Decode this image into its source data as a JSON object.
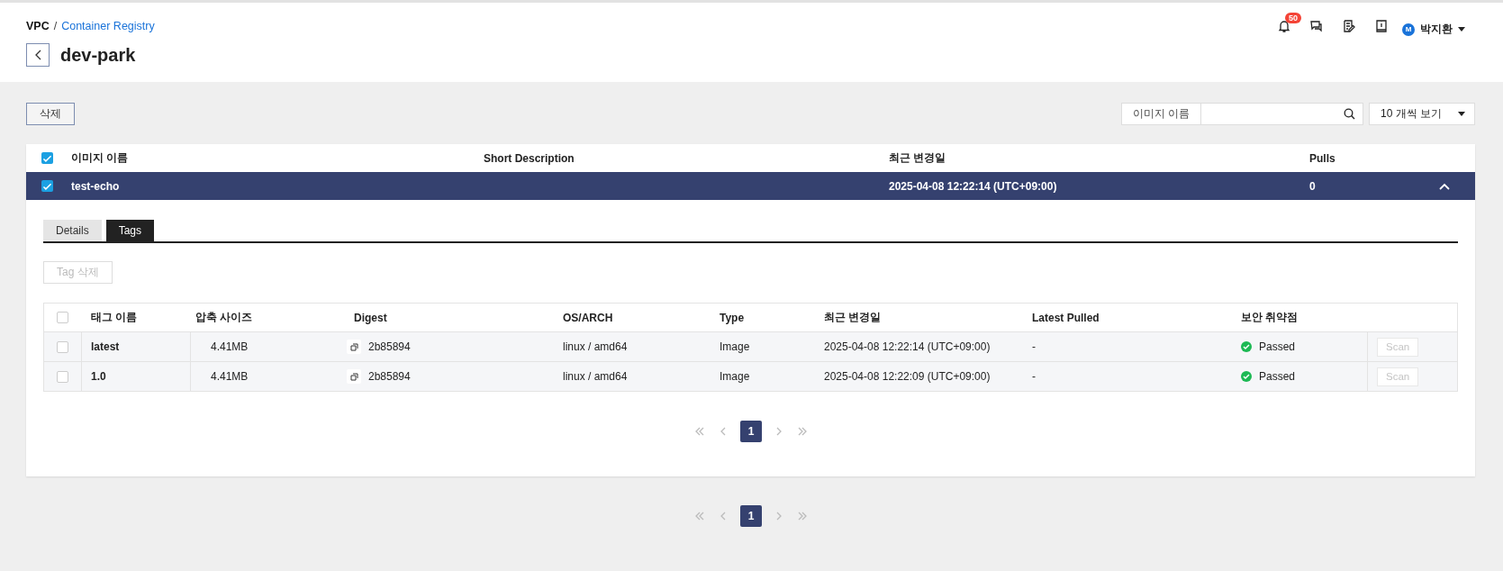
{
  "breadcrumb": {
    "items": [
      {
        "label": "VPC",
        "link": false
      },
      {
        "label": "Container Registry",
        "link": true
      }
    ],
    "separator": "/"
  },
  "header": {
    "notification_count": "50",
    "user": {
      "avatar": "M",
      "name": "박지환"
    }
  },
  "title": "dev-park",
  "toolbar": {
    "delete_button": "삭제",
    "search": {
      "label": "이미지 이름"
    },
    "page_size": "10 개씩 보기"
  },
  "table": {
    "header_checked": true,
    "columns": [
      "이미지 이름",
      "Short Description",
      "최근 변경일",
      "Pulls"
    ],
    "rows": [
      {
        "name": "test-echo",
        "modified": "2025-04-08 12:22:14 (UTC+09:00)",
        "pulls": "0",
        "checked": true,
        "selected": true,
        "expanded": true
      }
    ]
  },
  "detail": {
    "tabs": [
      {
        "label": "Details",
        "selected": false
      },
      {
        "label": "Tags",
        "selected": true
      }
    ],
    "tag_delete_button": {
      "label": "Tag 삭제",
      "disabled": true
    },
    "tags_table": {
      "header_checked": false,
      "columns": [
        "태그 이름",
        "압축 사이즈",
        "Digest",
        "OS/ARCH",
        "Type",
        "최근 변경일",
        "Latest Pulled",
        "보안 취약점"
      ],
      "rows": [
        {
          "checked": false,
          "name": "latest",
          "size": "4.41MB",
          "digest": "2b85894",
          "os_arch": "linux / amd64",
          "type": "Image",
          "modified": "2025-04-08 12:22:14 (UTC+09:00)",
          "latest_pulled": "-",
          "security": {
            "label": "Passed",
            "kind": "passed"
          },
          "scan": {
            "label": "Scan",
            "disabled": true
          }
        },
        {
          "checked": false,
          "name": "1.0",
          "size": "4.41MB",
          "digest": "2b85894",
          "os_arch": "linux / amd64",
          "type": "Image",
          "modified": "2025-04-08 12:22:09 (UTC+09:00)",
          "latest_pulled": "-",
          "security": {
            "label": "Passed",
            "kind": "passed"
          },
          "scan": {
            "label": "Scan",
            "disabled": true
          }
        }
      ]
    },
    "pagination": {
      "pages": [
        {
          "label": "1",
          "selected": true
        }
      ]
    }
  },
  "pagination": {
    "pages": [
      {
        "label": "1",
        "selected": true
      }
    ]
  }
}
